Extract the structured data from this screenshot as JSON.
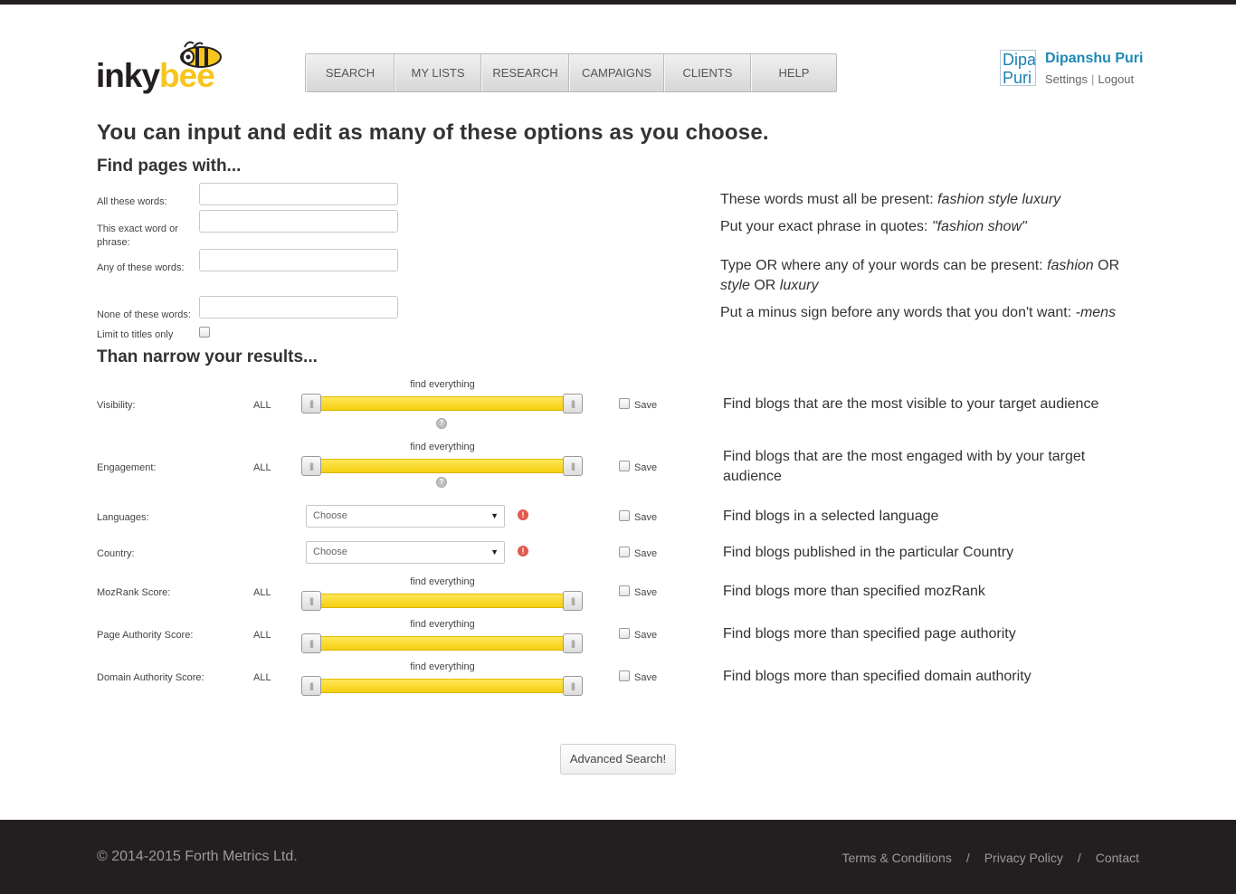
{
  "brand": {
    "part1": "inky",
    "part2": "bee",
    "accent": "#f7c51d"
  },
  "nav": [
    "SEARCH",
    "MY LISTS",
    "RESEARCH",
    "CAMPAIGNS",
    "CLIENTS",
    "HELP"
  ],
  "user": {
    "avatar_alt": "Dipanshu Puri",
    "name": "Dipanshu Puri",
    "settings": "Settings",
    "logout": "Logout"
  },
  "headline": "You can input and edit as many of these options as you choose.",
  "find_section": {
    "title": "Find pages with...",
    "fields": [
      {
        "label": "All these words:",
        "value": ""
      },
      {
        "label": "This exact word or phrase:",
        "value": ""
      },
      {
        "label": "Any of these words:",
        "value": ""
      },
      {
        "label": "None of these words:",
        "value": ""
      }
    ],
    "limit_label": "Limit to titles only",
    "limit_checked": false,
    "hints": {
      "all_prefix": "These words must all be present: ",
      "all_example": "fashion style luxury",
      "exact_prefix": "Put your exact phrase in quotes: ",
      "exact_example": "\"fashion show\"",
      "any_prefix": "Type OR where any of your words can be present: ",
      "any_w1": "fashion",
      "any_or1": " OR ",
      "any_w2": "style",
      "any_or2": " OR ",
      "any_w3": "luxury",
      "none_prefix": "Put a minus sign before any words that you don't want: ",
      "none_example": "-mens"
    }
  },
  "narrow_section": {
    "title": "Than narrow your results...",
    "find_everything": "find everything",
    "all_text": "ALL",
    "save_label": "Save",
    "help_mark": "?",
    "warn_mark": "!",
    "grip": "|||",
    "select_caret": "▼",
    "rows": {
      "visibility": {
        "label": "Visibility:",
        "hint": "Find blogs that are the most visible to your target audience"
      },
      "engagement": {
        "label": "Engagement:",
        "hint": "Find blogs that are the most engaged with by your target audience"
      },
      "languages": {
        "label": "Languages:",
        "select": "Choose",
        "hint": "Find blogs in a selected language"
      },
      "country": {
        "label": "Country:",
        "select": "Choose",
        "hint": "Find blogs published in the particular Country"
      },
      "mozrank": {
        "label": "MozRank Score:",
        "hint": "Find blogs more than specified mozRank"
      },
      "page_authority": {
        "label": "Page Authority Score:",
        "hint": "Find blogs more than specified page authority"
      },
      "domain_authority": {
        "label": "Domain Authority Score:",
        "hint": "Find blogs more than specified domain authority"
      }
    },
    "slider_range": {
      "min": 0,
      "max": 1
    }
  },
  "search_button": "Advanced Search!",
  "footer": {
    "copyright": "© 2014-2015 Forth Metrics Ltd.",
    "terms": "Terms & Conditions",
    "privacy": "Privacy Policy",
    "contact": "Contact",
    "separator": "/"
  }
}
